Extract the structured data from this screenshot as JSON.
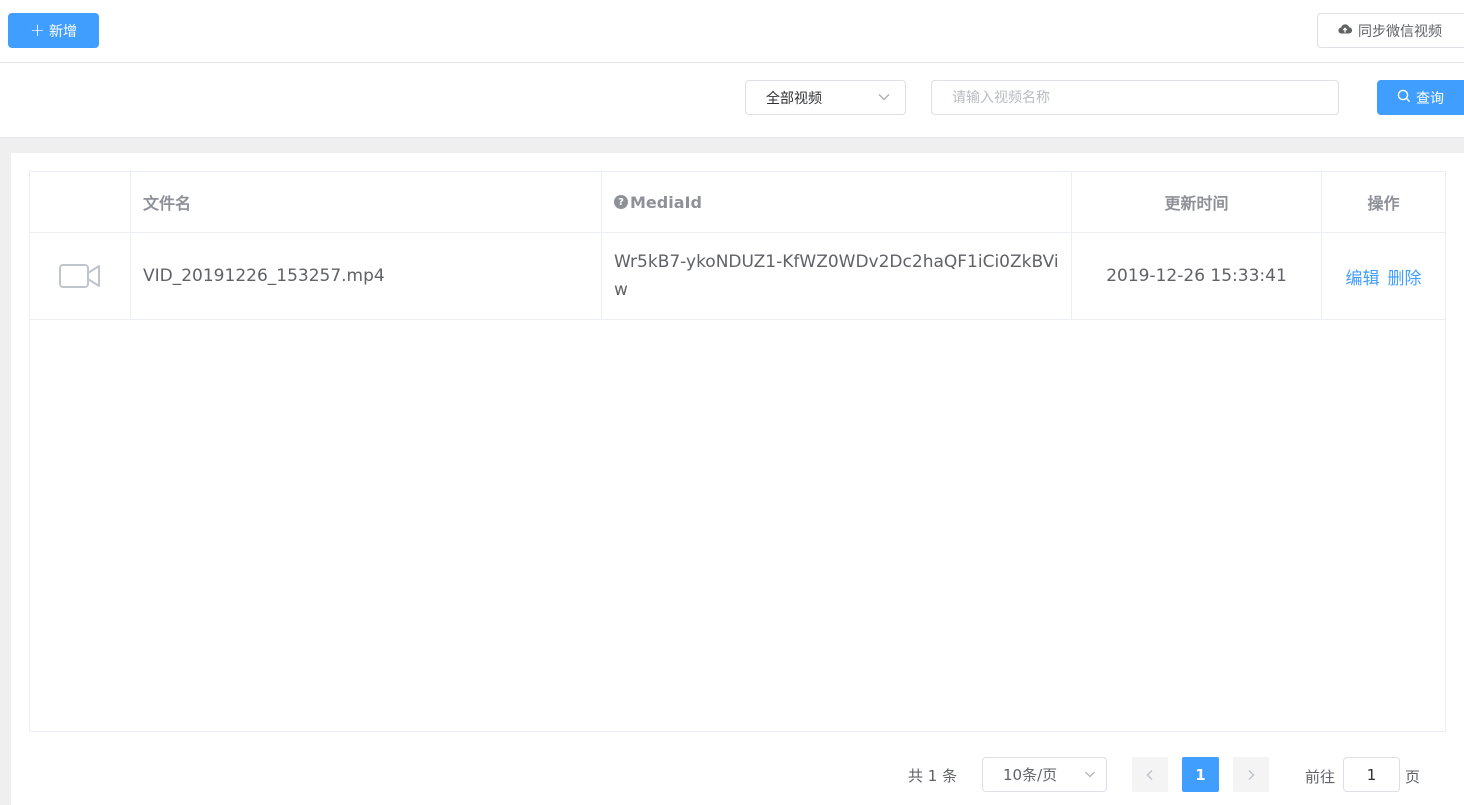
{
  "toolbar": {
    "add_label": "新增",
    "sync_label": "同步微信视频"
  },
  "filters": {
    "type_selected": "全部视频",
    "search_placeholder": "请输入视频名称",
    "search_value": "",
    "query_label": "查询"
  },
  "table": {
    "columns": [
      "",
      "文件名",
      "MediaId",
      "更新时间",
      "操作"
    ],
    "rows": [
      {
        "icon": "video-camera-icon",
        "filename": "VID_20191226_153257.mp4",
        "media_id": "Wr5kB7-ykoNDUZ1-KfWZ0WDv2Dc2haQF1iCi0ZkBViw",
        "updated": "2019-12-26 15:33:41",
        "edit_label": "编辑",
        "delete_label": "删除"
      }
    ]
  },
  "pagination": {
    "total_text": "共 1 条",
    "page_size": "10条/页",
    "current_page": "1",
    "goto_prefix": "前往",
    "goto_value": "1",
    "goto_suffix": "页"
  },
  "colors": {
    "primary": "#409eff",
    "border": "#dcdfe6",
    "text": "#606266",
    "header_text": "#8e9198"
  }
}
